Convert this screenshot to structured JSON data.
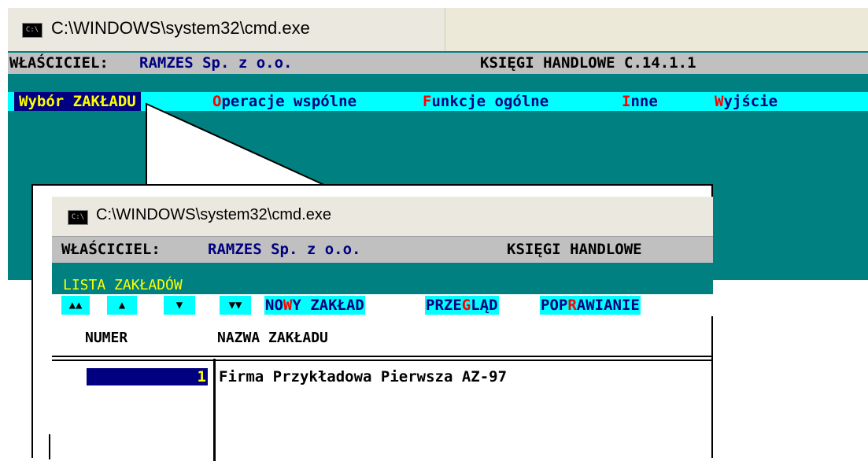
{
  "back_window": {
    "title": "C:\\WINDOWS\\system32\\cmd.exe",
    "icon": "console-icon",
    "owner_label": "WŁAŚCICIEL:",
    "owner_name": "RAMZES Sp. z o.o.",
    "app_name": "KSIĘGI HANDLOWE C.14.1.1",
    "menu": {
      "selected": "Wybór ZAKŁADU",
      "items": [
        {
          "hotkey": "O",
          "rest": "peracje wspólne"
        },
        {
          "hotkey": "F",
          "rest": "unkcje ogólne"
        },
        {
          "hotkey": "I",
          "rest": "nne"
        },
        {
          "hotkey": "W",
          "rest": "yjście"
        }
      ]
    }
  },
  "zoom_window": {
    "title": "C:\\WINDOWS\\system32\\cmd.exe",
    "icon": "console-icon",
    "owner_label": "WŁAŚCICIEL:",
    "owner_name": "RAMZES Sp. z o.o.",
    "app_name": "KSIĘGI HANDLOWE",
    "list_title": "LISTA ZAKŁADÓW",
    "nav_buttons": [
      "▲▲",
      "▲",
      "▼",
      "▼▼"
    ],
    "commands": [
      {
        "pre": "NO",
        "hotkey": "W",
        "post": "Y ZAKŁAD"
      },
      {
        "pre": "PRZE",
        "hotkey": "G",
        "post": "LĄD"
      },
      {
        "pre": "POP",
        "hotkey": "R",
        "post": "AWIANIE"
      }
    ],
    "headers": {
      "numer": "NUMER",
      "nazwa": "NAZWA ZAKŁADU"
    },
    "rows": [
      {
        "numer": "1",
        "nazwa": "Firma Przykładowa Pierwsza AZ-97"
      }
    ]
  },
  "colors": {
    "teal": "#008080",
    "cyan": "#00ffff",
    "navy": "#000080",
    "yellow": "#ffff00",
    "red": "#ff0000",
    "gray": "#c0c0c0"
  }
}
